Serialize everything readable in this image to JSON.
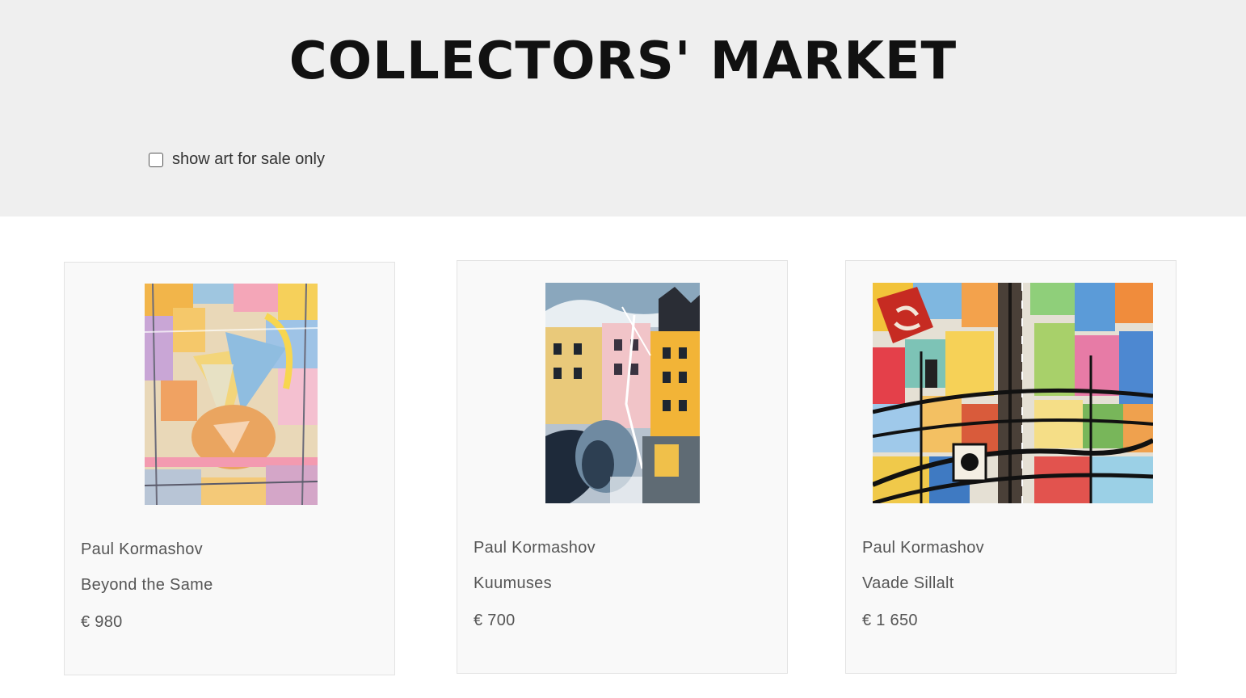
{
  "header": {
    "title": "COLLECTORS' MARKET"
  },
  "filter": {
    "label": "show art for sale only",
    "checked": false
  },
  "artworks": [
    {
      "artist": "Paul Kormashov",
      "title": "Beyond the Same",
      "price": "€ 980"
    },
    {
      "artist": "Paul Kormashov",
      "title": "Kuumuses",
      "price": "€ 700"
    },
    {
      "artist": "Paul Kormashov",
      "title": "Vaade Sillalt",
      "price": "€ 1 650"
    }
  ],
  "colors": {
    "header_bg": "#efefef",
    "card_bg": "#f9f9f9",
    "card_border": "#e3e3e3",
    "title_text": "#111111",
    "meta_text": "#555555"
  }
}
